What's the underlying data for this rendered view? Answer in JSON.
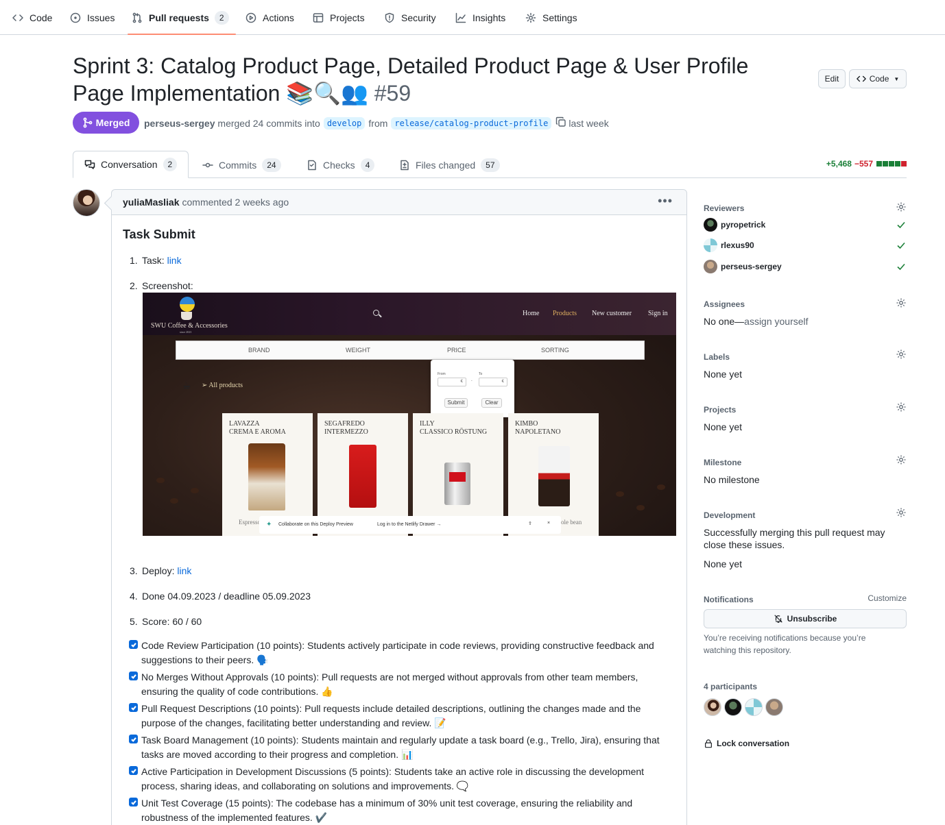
{
  "repo_nav": {
    "items": [
      {
        "label": "Code",
        "icon": "code-icon"
      },
      {
        "label": "Issues",
        "icon": "issue-icon"
      },
      {
        "label": "Pull requests",
        "icon": "pull-request-icon",
        "count": "2",
        "active": true
      },
      {
        "label": "Actions",
        "icon": "play-icon"
      },
      {
        "label": "Projects",
        "icon": "table-icon"
      },
      {
        "label": "Security",
        "icon": "shield-icon"
      },
      {
        "label": "Insights",
        "icon": "graph-icon"
      },
      {
        "label": "Settings",
        "icon": "gear-icon"
      }
    ]
  },
  "header": {
    "title": "Sprint 3: Catalog Product Page, Detailed Product Page & User Profile Page Implementation 📚🔍👥",
    "number": "#59",
    "edit_label": "Edit",
    "code_label": "Code",
    "state": "Merged",
    "author": "perseus-sergey",
    "merged_text": "merged 24 commits into",
    "base_branch": "develop",
    "from_text": "from",
    "head_branch": "release/catalog-product-profile",
    "time": "last week"
  },
  "tabs": [
    {
      "label": "Conversation",
      "count": "2",
      "icon": "comment-discussion-icon"
    },
    {
      "label": "Commits",
      "count": "24",
      "icon": "commit-icon"
    },
    {
      "label": "Checks",
      "count": "4",
      "icon": "checklist-icon"
    },
    {
      "label": "Files changed",
      "count": "57",
      "icon": "file-diff-icon"
    }
  ],
  "diffstat": {
    "additions": "+5,468",
    "deletions": "−557",
    "green_blocks": 4,
    "red_blocks": 1,
    "gray_blocks": 0
  },
  "comment": {
    "author": "yuliaMasliak",
    "action": "commented 2 weeks ago",
    "heading": "Task Submit",
    "items": [
      {
        "n": "1.",
        "label": "Task: ",
        "link": "link"
      },
      {
        "n": "2.",
        "label": "Screenshot:"
      },
      {
        "n": "3.",
        "label": "Deploy: ",
        "link": "link"
      },
      {
        "n": "4.",
        "label": "Done 04.09.2023 / deadline 05.09.2023"
      },
      {
        "n": "5.",
        "label": "Score: 60 / 60"
      }
    ],
    "tasks": [
      "Code Review Participation (10 points): Students actively participate in code reviews, providing constructive feedback and suggestions to their peers. 🗣️",
      "No Merges Without Approvals (10 points): Pull requests are not merged without approvals from other team members, ensuring the quality of code contributions. 👍",
      "Pull Request Descriptions (10 points): Pull requests include detailed descriptions, outlining the changes made and the purpose of the changes, facilitating better understanding and review. 📝",
      "Task Board Management (10 points): Students maintain and regularly update a task board (e.g., Trello, Jira), ensuring that tasks are moved according to their progress and completion. 📊",
      "Active Participation in Development Discussions (5 points): Students take an active role in discussing the development process, sharing ideas, and collaborating on solutions and improvements. 🗨️",
      "Unit Test Coverage (15 points): The codebase has a minimum of 30% unit test coverage, ensuring the reliability and robustness of the implemented features. ✔️"
    ]
  },
  "screenshot": {
    "brand": "SWU Coffee & Accessories",
    "since": "since 2023",
    "nav": [
      "Home",
      "Products",
      "New customer",
      "Sign in"
    ],
    "filters": [
      "BRAND",
      "WEIGHT",
      "PRICE",
      "SORTING"
    ],
    "price_from": "From",
    "price_to": "To",
    "currency": "€",
    "dash": "-",
    "submit": "Submit",
    "clear": "Clear",
    "all_products": "➢ All products",
    "cards": [
      {
        "title": "LAVAZZA\nCREMA E AROMA"
      },
      {
        "title": "SEGAFREDO\nINTERMEZZO"
      },
      {
        "title": "ILLY\nCLASSICO RÖSTUNG"
      },
      {
        "title": "KIMBO\nNAPOLETANO"
      }
    ],
    "footer_left": "Espresso",
    "footer_right": "ole bean",
    "netlify_collab": "Collaborate on this Deploy Preview",
    "netlify_login": "Log in to the Netlify Drawer →"
  },
  "sidebar": {
    "reviewers_title": "Reviewers",
    "reviewers": [
      "pyropetrick",
      "rlexus90",
      "perseus-sergey"
    ],
    "assignees_title": "Assignees",
    "assignees_value": "No one—",
    "assignees_link": "assign yourself",
    "labels_title": "Labels",
    "labels_value": "None yet",
    "projects_title": "Projects",
    "projects_value": "None yet",
    "milestone_title": "Milestone",
    "milestone_value": "No milestone",
    "development_title": "Development",
    "development_text": "Successfully merging this pull request may close these issues.",
    "development_value": "None yet",
    "notifications_title": "Notifications",
    "customize": "Customize",
    "unsubscribe": "Unsubscribe",
    "notif_text": "You’re receiving notifications because you’re watching this repository.",
    "participants_title": "4 participants",
    "lock": "Lock conversation"
  },
  "colors": {
    "merged": "#8250df",
    "link": "#0969da",
    "accent_underline": "#fd8c73",
    "success": "#1a7f37",
    "danger": "#cf222e"
  }
}
